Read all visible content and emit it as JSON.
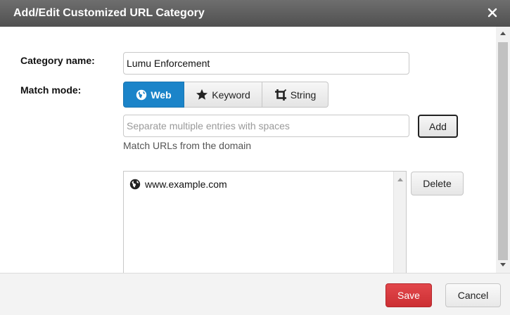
{
  "dialog": {
    "title": "Add/Edit Customized URL Category",
    "close_icon": "close-icon"
  },
  "form": {
    "category_name_label": "Category name:",
    "category_name_value": "Lumu Enforcement",
    "match_mode_label": "Match mode:",
    "match_modes": [
      {
        "label": "Web",
        "icon": "globe-icon",
        "selected": true
      },
      {
        "label": "Keyword",
        "icon": "star-icon",
        "selected": false
      },
      {
        "label": "String",
        "icon": "crop-icon",
        "selected": false
      }
    ],
    "entry_placeholder": "Separate multiple entries with spaces",
    "entry_value": "",
    "add_label": "Add",
    "hint": "Match URLs from the domain",
    "entries": [
      {
        "text": "www.example.com",
        "icon": "globe-icon"
      }
    ],
    "delete_label": "Delete"
  },
  "footer": {
    "save_label": "Save",
    "cancel_label": "Cancel"
  },
  "colors": {
    "titlebar": "#5c5c5c",
    "accent": "#1b84c9",
    "save": "#d63a3e"
  }
}
